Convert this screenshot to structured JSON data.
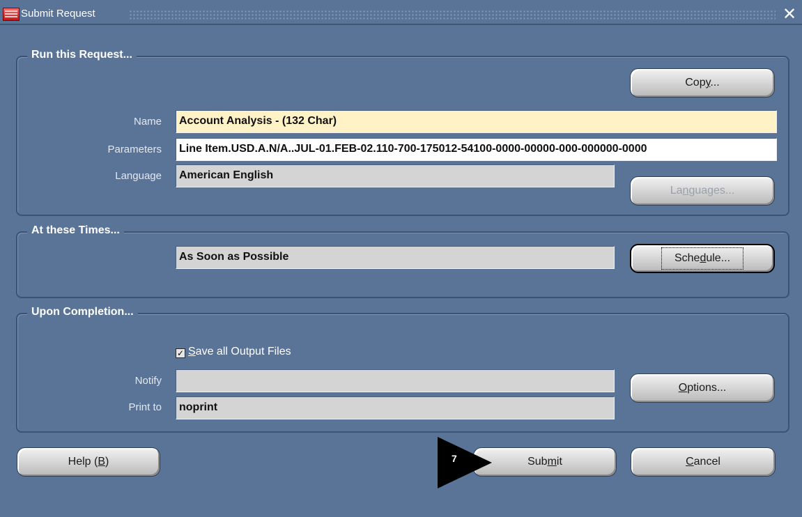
{
  "window": {
    "title": "Submit Request",
    "close_glyph": "✕",
    "icon": "oracle-app-icon"
  },
  "run_request": {
    "label": "Run this Request...",
    "copy_button": {
      "label_pre": "Cop",
      "label_mn": "y",
      "label_post": "..."
    },
    "name_label": "Name",
    "name_value": "Account Analysis - (132 Char)",
    "parameters_label": "Parameters",
    "parameters_value": "Line Item.USD.A.N/A..JUL-01.FEB-02.110-700-175012-54100-0000-00000-000-000000-0000",
    "language_label": "Language",
    "language_value": "American English",
    "languages_button": {
      "label_pre": "La",
      "label_mn": "n",
      "label_post": "guages..."
    }
  },
  "at_times": {
    "label": "At these Times...",
    "schedule_value": "As Soon as Possible",
    "schedule_button": {
      "label_pre": "Sche",
      "label_mn": "d",
      "label_post": "ule..."
    }
  },
  "upon_completion": {
    "label": "Upon Completion...",
    "save_output": {
      "checked": true,
      "check_glyph": "✓",
      "label_mn": "S",
      "label_post": "ave all Output Files"
    },
    "notify_label": "Notify",
    "notify_value": "",
    "print_to_label": "Print to",
    "print_to_value": "noprint",
    "options_button": {
      "label_mn": "O",
      "label_post": "ptions..."
    }
  },
  "footer": {
    "help_button": {
      "label_pre": "Help (",
      "label_mn": "B",
      "label_post": ")"
    },
    "submit_button": {
      "label_pre": "Sub",
      "label_mn": "m",
      "label_post": "it"
    },
    "cancel_button": {
      "label_mn": "C",
      "label_post": "ancel"
    }
  },
  "callout": {
    "number": "7",
    "color": "#000000"
  },
  "colors": {
    "window_bg": "#5a7498",
    "required_field": "#fff2c6",
    "readonly_field": "#d4d4d4"
  }
}
